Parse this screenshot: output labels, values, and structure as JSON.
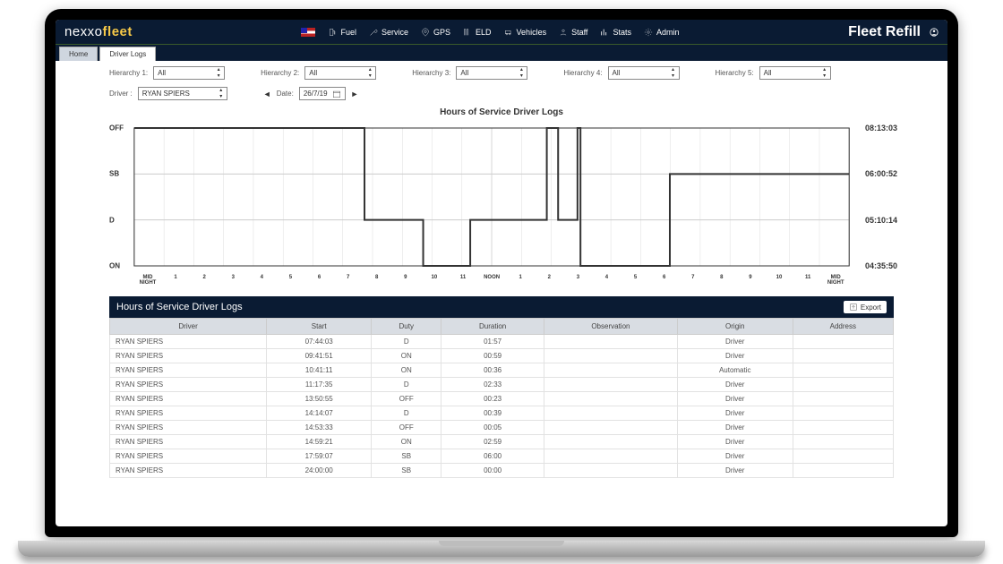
{
  "brand_prefix": "nexxo",
  "brand_suffix": "fleet",
  "nav": [
    {
      "icon": "fuel-icon",
      "label": "Fuel"
    },
    {
      "icon": "service-icon",
      "label": "Service"
    },
    {
      "icon": "gps-icon",
      "label": "GPS"
    },
    {
      "icon": "eld-icon",
      "label": "ELD"
    },
    {
      "icon": "vehicles-icon",
      "label": "Vehicles"
    },
    {
      "icon": "staff-icon",
      "label": "Staff"
    },
    {
      "icon": "stats-icon",
      "label": "Stats"
    },
    {
      "icon": "admin-icon",
      "label": "Admin"
    }
  ],
  "corner_brand_a": "Fleet",
  "corner_brand_b": "Refill",
  "tabs": {
    "home": "Home",
    "driver_logs": "Driver Logs"
  },
  "filters": {
    "h1_label": "Hierarchy 1:",
    "h1_value": "All",
    "h2_label": "Hierarchy 2:",
    "h2_value": "All",
    "h3_label": "Hierarchy 3:",
    "h3_value": "All",
    "h4_label": "Hierarchy 4:",
    "h4_value": "All",
    "h5_label": "Hierarchy 5:",
    "h5_value": "All",
    "driver_label": "Driver :",
    "driver_value": "RYAN SPIERS",
    "date_label": "Date:",
    "date_value": "26/7/19"
  },
  "chart_title": "Hours of Service Driver Logs",
  "chart_data": {
    "type": "step-line",
    "y_categories": [
      "OFF",
      "SB",
      "D",
      "ON"
    ],
    "y_totals": {
      "OFF": "08:13:03",
      "SB": "06:00:52",
      "D": "05:10:14",
      "ON": "04:35:50"
    },
    "x_range_hours": [
      0,
      24
    ],
    "x_ticks": [
      "MID NIGHT",
      "1",
      "2",
      "3",
      "4",
      "5",
      "6",
      "7",
      "8",
      "9",
      "10",
      "11",
      "NOON",
      "1",
      "2",
      "3",
      "4",
      "5",
      "6",
      "7",
      "8",
      "9",
      "10",
      "11",
      "MID NIGHT"
    ],
    "segments": [
      {
        "state": "OFF",
        "from_h": 0.0,
        "to_h": 7.73
      },
      {
        "state": "D",
        "from_h": 7.73,
        "to_h": 9.7
      },
      {
        "state": "ON",
        "from_h": 9.7,
        "to_h": 10.68
      },
      {
        "state": "ON",
        "from_h": 10.68,
        "to_h": 11.28
      },
      {
        "state": "D",
        "from_h": 11.28,
        "to_h": 13.85
      },
      {
        "state": "OFF",
        "from_h": 13.85,
        "to_h": 14.23
      },
      {
        "state": "D",
        "from_h": 14.23,
        "to_h": 14.88
      },
      {
        "state": "OFF",
        "from_h": 14.88,
        "to_h": 14.98
      },
      {
        "state": "ON",
        "from_h": 14.98,
        "to_h": 17.98
      },
      {
        "state": "SB",
        "from_h": 17.98,
        "to_h": 24.0
      }
    ]
  },
  "table": {
    "title": "Hours of Service Driver Logs",
    "export": "Export",
    "columns": [
      "Driver",
      "Start",
      "Duty",
      "Duration",
      "Observation",
      "Origin",
      "Address"
    ],
    "rows": [
      [
        "RYAN SPIERS",
        "07:44:03",
        "D",
        "01:57",
        "",
        "Driver",
        ""
      ],
      [
        "RYAN SPIERS",
        "09:41:51",
        "ON",
        "00:59",
        "",
        "Driver",
        ""
      ],
      [
        "RYAN SPIERS",
        "10:41:11",
        "ON",
        "00:36",
        "",
        "Automatic",
        ""
      ],
      [
        "RYAN SPIERS",
        "11:17:35",
        "D",
        "02:33",
        "",
        "Driver",
        ""
      ],
      [
        "RYAN SPIERS",
        "13:50:55",
        "OFF",
        "00:23",
        "",
        "Driver",
        ""
      ],
      [
        "RYAN SPIERS",
        "14:14:07",
        "D",
        "00:39",
        "",
        "Driver",
        ""
      ],
      [
        "RYAN SPIERS",
        "14:53:33",
        "OFF",
        "00:05",
        "",
        "Driver",
        ""
      ],
      [
        "RYAN SPIERS",
        "14:59:21",
        "ON",
        "02:59",
        "",
        "Driver",
        ""
      ],
      [
        "RYAN SPIERS",
        "17:59:07",
        "SB",
        "06:00",
        "",
        "Driver",
        ""
      ],
      [
        "RYAN SPIERS",
        "24:00:00",
        "SB",
        "00:00",
        "",
        "Driver",
        ""
      ]
    ]
  }
}
